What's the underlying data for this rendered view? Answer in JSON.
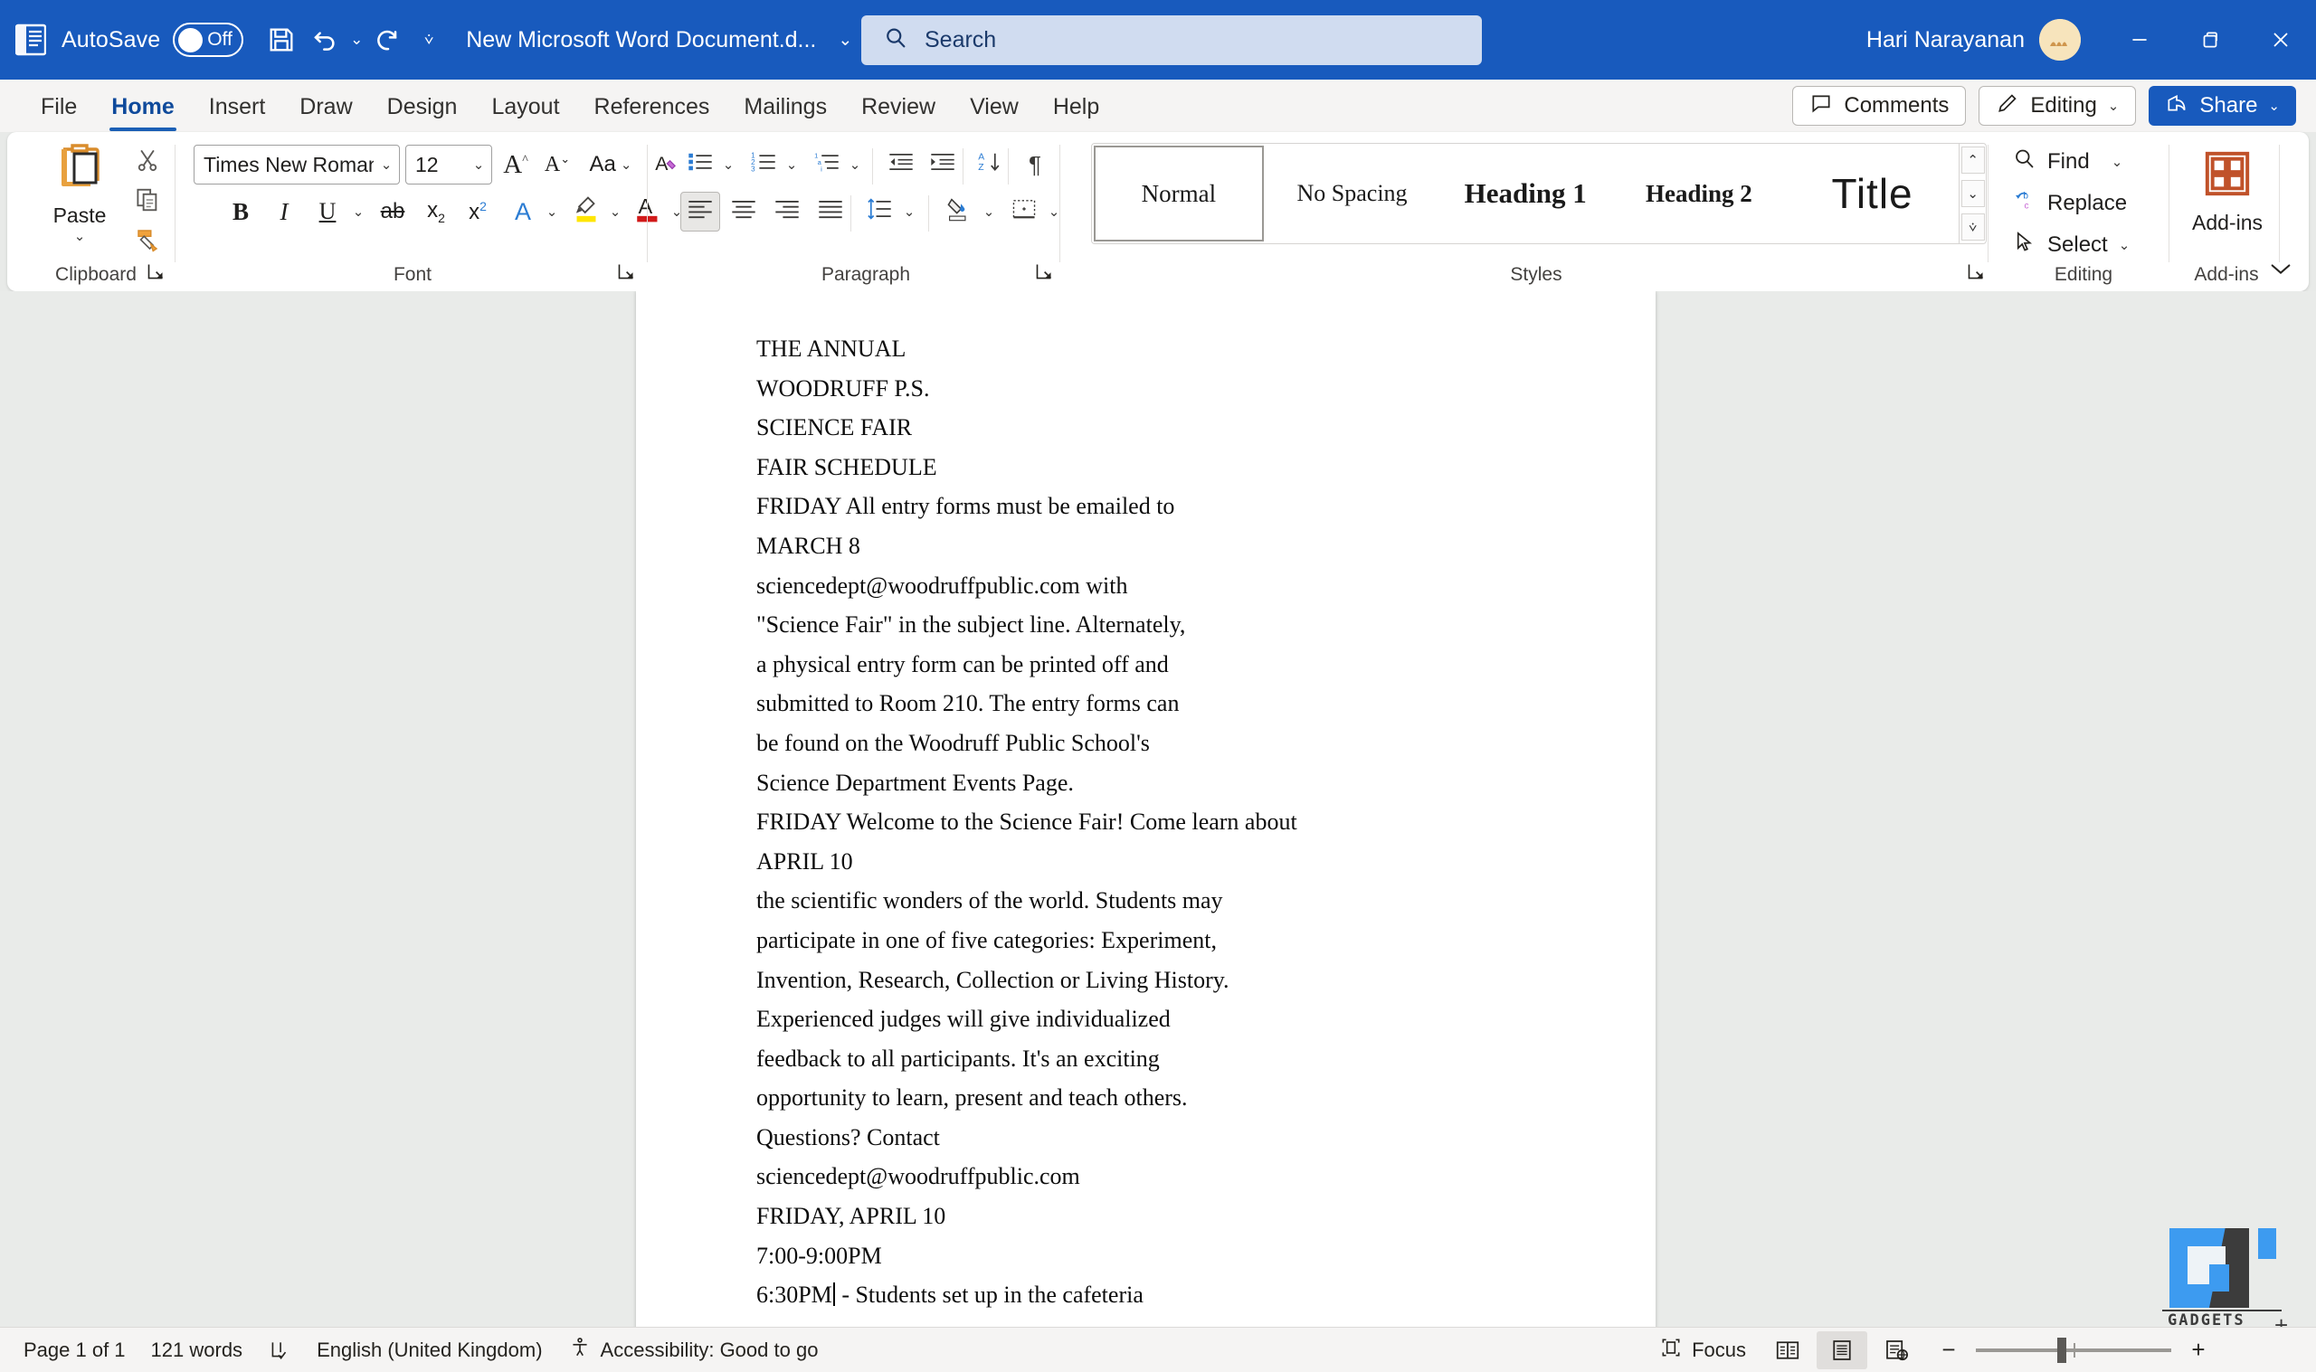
{
  "titlebar": {
    "app_icon": "word-logo-icon",
    "autosave_label": "AutoSave",
    "autosave_state": "Off",
    "save_icon": "save-icon",
    "undo_icon": "undo-icon",
    "redo_icon": "redo-icon",
    "qat_more_icon": "quick-access-more-icon",
    "document_title": "New Microsoft Word Document.d...",
    "title_caret_icon": "chevron-down-icon",
    "user_name": "Hari Narayanan",
    "avatar_icon": "user-avatar",
    "minimize_icon": "minimize-icon",
    "restore_icon": "restore-icon",
    "close_icon": "close-icon"
  },
  "search": {
    "icon": "search-icon",
    "placeholder": "Search"
  },
  "tabs": [
    {
      "label": "File",
      "active": false
    },
    {
      "label": "Home",
      "active": true
    },
    {
      "label": "Insert",
      "active": false
    },
    {
      "label": "Draw",
      "active": false
    },
    {
      "label": "Design",
      "active": false
    },
    {
      "label": "Layout",
      "active": false
    },
    {
      "label": "References",
      "active": false
    },
    {
      "label": "Mailings",
      "active": false
    },
    {
      "label": "Review",
      "active": false
    },
    {
      "label": "View",
      "active": false
    },
    {
      "label": "Help",
      "active": false
    }
  ],
  "tab_actions": {
    "comments_label": "Comments",
    "comments_icon": "comment-icon",
    "editing_label": "Editing",
    "editing_icon": "pencil-icon",
    "editing_caret": "chevron-down-icon",
    "share_label": "Share",
    "share_icon": "share-icon",
    "share_caret": "chevron-down-icon"
  },
  "ribbon": {
    "clipboard": {
      "group_label": "Clipboard",
      "paste_label": "Paste",
      "paste_icon": "paste-icon",
      "paste_caret": "chevron-down-icon",
      "cut_icon": "scissors-icon",
      "copy_icon": "copy-icon",
      "format_painter_icon": "format-painter-icon",
      "dialog_launcher_icon": "dialog-launcher-icon"
    },
    "font": {
      "group_label": "Font",
      "font_family_value": "Times New Roman",
      "font_size_value": "12",
      "grow_font_icon": "grow-font-icon",
      "shrink_font_icon": "shrink-font-icon",
      "change_case_icon": "change-case-icon",
      "clear_formatting_icon": "clear-formatting-icon",
      "bold_icon": "bold-icon",
      "italic_icon": "italic-icon",
      "underline_icon": "underline-icon",
      "strikethrough_icon": "strikethrough-icon",
      "subscript_icon": "subscript-icon",
      "superscript_icon": "superscript-icon",
      "text_effects_icon": "text-effects-icon",
      "highlight_icon": "text-highlight-icon",
      "font_color_icon": "font-color-icon",
      "dialog_launcher_icon": "dialog-launcher-icon"
    },
    "paragraph": {
      "group_label": "Paragraph",
      "bullets_icon": "bullets-icon",
      "numbering_icon": "numbering-icon",
      "multilevel_icon": "multilevel-list-icon",
      "decrease_indent_icon": "decrease-indent-icon",
      "increase_indent_icon": "increase-indent-icon",
      "sort_icon": "sort-icon",
      "show_marks_icon": "show-formatting-marks-icon",
      "align_left_icon": "align-left-icon",
      "align_center_icon": "align-center-icon",
      "align_right_icon": "align-right-icon",
      "justify_icon": "justify-icon",
      "line_spacing_icon": "line-spacing-icon",
      "shading_icon": "shading-icon",
      "borders_icon": "borders-icon",
      "dialog_launcher_icon": "dialog-launcher-icon"
    },
    "styles": {
      "group_label": "Styles",
      "items": [
        {
          "label": "Normal",
          "selected": true
        },
        {
          "label": "No Spacing",
          "selected": false
        },
        {
          "label": "Heading 1",
          "selected": false
        },
        {
          "label": "Heading 2",
          "selected": false
        },
        {
          "label": "Title",
          "selected": false
        }
      ],
      "scroll_up_icon": "chevron-up-icon",
      "scroll_down_icon": "chevron-down-icon",
      "more_styles_icon": "more-styles-icon",
      "dialog_launcher_icon": "dialog-launcher-icon"
    },
    "editing": {
      "group_label": "Editing",
      "find_label": "Find",
      "find_icon": "search-icon",
      "find_caret": "chevron-down-icon",
      "replace_label": "Replace",
      "replace_icon": "replace-icon",
      "select_label": "Select",
      "select_icon": "cursor-arrow-icon",
      "select_caret": "chevron-down-icon"
    },
    "addins": {
      "group_label": "Add-ins",
      "button_label": "Add-ins",
      "icon": "addins-grid-icon"
    },
    "collapse_icon": "chevron-up-icon"
  },
  "document": {
    "lines": [
      "THE ANNUAL",
      "WOODRUFF P.S.",
      "SCIENCE FAIR",
      "FAIR SCHEDULE",
      "FRIDAY All entry forms must be emailed to",
      "MARCH 8",
      "sciencedept@woodruffpublic.com with",
      "\"Science Fair\" in the subject line. Alternately,",
      "a physical entry form can be printed off and",
      "submitted to Room 210. The entry forms can",
      "be found on the Woodruff Public School's",
      "Science Department Events Page.",
      "FRIDAY Welcome to the Science Fair! Come learn about",
      "APRIL 10",
      "the scientific wonders of the world. Students may",
      "participate in one of five categories: Experiment,",
      "Invention, Research, Collection or Living History.",
      "Experienced judges will give individualized",
      "feedback to all participants. It's an exciting",
      "opportunity to learn, present and teach others.",
      "Questions? Contact",
      "sciencedept@woodruffpublic.com",
      "FRIDAY, APRIL 10",
      "7:00-9:00PM"
    ],
    "caret_line_before": "6:30PM",
    "caret_line_after": " - Students set up in the cafeteria"
  },
  "watermark": {
    "text": "GADGETS",
    "plus": "+"
  },
  "statusbar": {
    "page_info": "Page 1 of 1",
    "word_count": "121 words",
    "proofing_icon": "proofing-errors-icon",
    "language": "English (United Kingdom)",
    "accessibility_icon": "accessibility-icon",
    "accessibility": "Accessibility: Good to go",
    "focus_label": "Focus",
    "focus_icon": "focus-icon",
    "read_mode_icon": "read-mode-icon",
    "print_layout_icon": "print-layout-icon",
    "web_layout_icon": "web-layout-icon",
    "zoom_out_icon": "zoom-out-icon",
    "zoom_in_icon": "zoom-in-icon",
    "zoom_level": ""
  },
  "colors": {
    "brand_blue": "#185abd",
    "tab_active": "#1b5fb5",
    "ribbon_bg": "#ffffff",
    "canvas_bg": "#e9ebe9",
    "statusbar_bg": "#f5f4f3"
  }
}
